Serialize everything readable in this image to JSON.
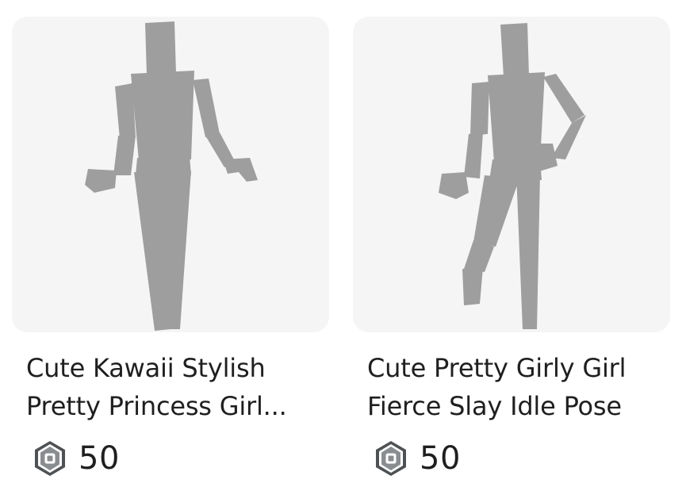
{
  "items": [
    {
      "name": "Cute Kawaii Stylish Pretty Princess Girl...",
      "price": "50",
      "currency_icon": "robux-icon",
      "thumbnail": "idle-pose-figure"
    },
    {
      "name": "Cute Pretty Girly Girl Fierce Slay Idle Pose",
      "price": "50",
      "currency_icon": "robux-icon",
      "thumbnail": "hand-on-hip-pose-figure"
    }
  ],
  "colors": {
    "thumbnail_bg": "#f5f5f5",
    "figure": "#9e9e9e",
    "text": "#1f1f21",
    "icon_outer": "#4f5254",
    "icon_inner": "#8a8d90"
  }
}
